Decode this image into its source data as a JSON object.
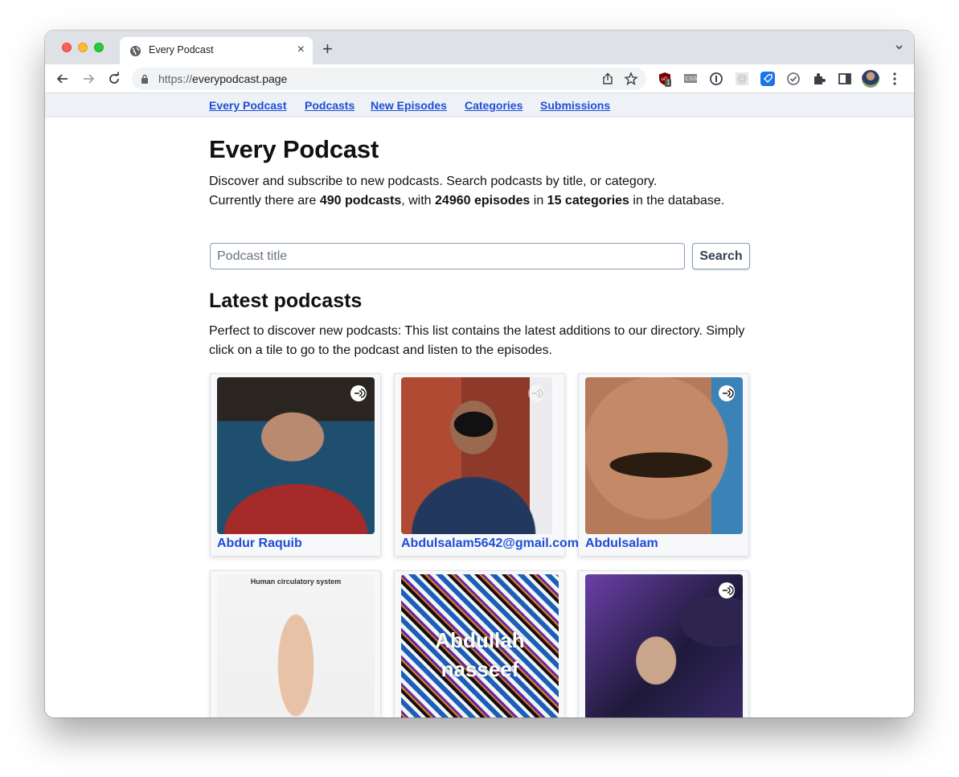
{
  "browser": {
    "tab_title": "Every Podcast",
    "url_scheme": "https://",
    "url_host": "everypodcast.page",
    "extension_badge": "1",
    "new_tab_label": "+",
    "close_tab_label": "×"
  },
  "nav": {
    "links": [
      "Every Podcast",
      "Podcasts",
      "New Episodes",
      "Categories",
      "Submissions"
    ]
  },
  "header": {
    "title": "Every Podcast",
    "intro_line1": "Discover and subscribe to new podcasts. Search podcasts by title, or category.",
    "intro_prefix": "Currently there are ",
    "podcasts_count": "490 podcasts",
    "intro_mid1": ", with ",
    "episodes_count": "24960 episodes",
    "intro_mid2": " in ",
    "categories_count": "15 categories",
    "intro_suffix": " in the database."
  },
  "search": {
    "placeholder": "Podcast title",
    "value": "",
    "button_label": "Search"
  },
  "latest": {
    "title": "Latest podcasts",
    "description": "Perfect to discover new podcasts: This list contains the latest additions to our directory. Simply click on a tile to go to the podcast and listen to the episodes.",
    "tiles": [
      {
        "name": "Abdur Raquib"
      },
      {
        "name": "Abdulsalam5642@gmail.com"
      },
      {
        "name": "Abdulsalam"
      },
      {
        "name": "",
        "art_text": "Human circulatory system"
      },
      {
        "name": "",
        "art_text": "Abdullah nasseef"
      },
      {
        "name": ""
      }
    ]
  }
}
